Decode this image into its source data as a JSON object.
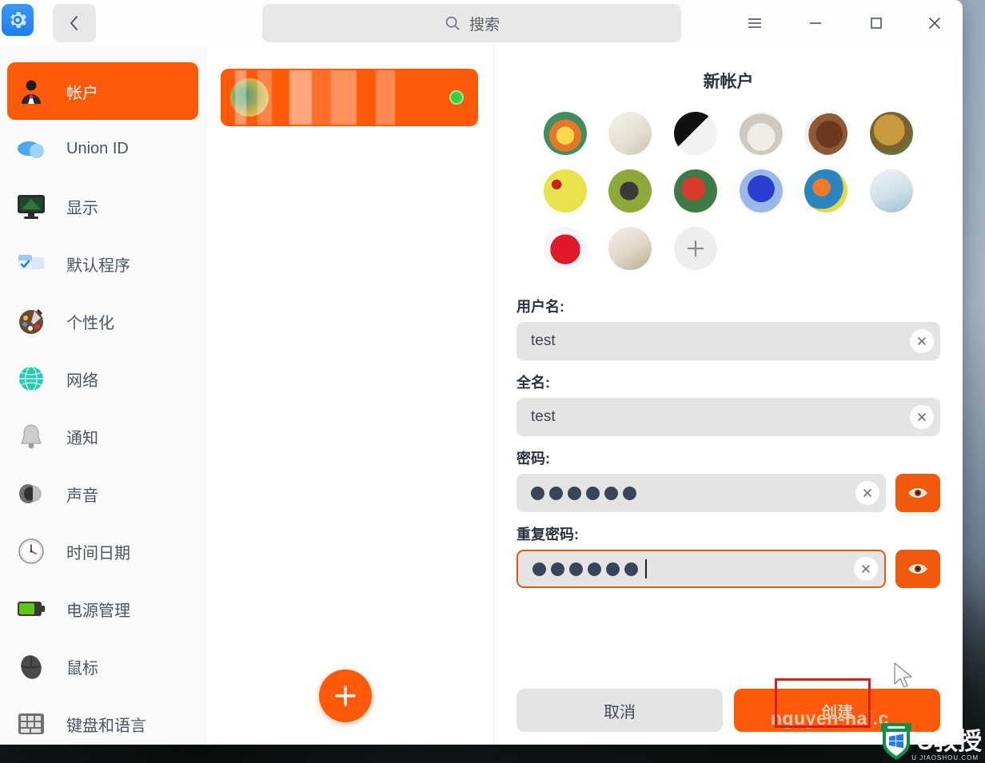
{
  "window": {
    "app_icon": "settings-gear-icon",
    "back_label": "‹",
    "controls": {
      "menu": "hamburger-menu-icon",
      "minimize": "minimize-icon",
      "maximize": "maximize-icon",
      "close": "close-icon"
    }
  },
  "search": {
    "placeholder": "搜索",
    "icon": "search-icon"
  },
  "sidebar": {
    "items": [
      {
        "label": "帐户",
        "icon": "user-account-icon",
        "active": true
      },
      {
        "label": "Union ID",
        "icon": "cloud-icon",
        "active": false
      },
      {
        "label": "显示",
        "icon": "monitor-icon",
        "active": false
      },
      {
        "label": "默认程序",
        "icon": "default-apps-icon",
        "active": false
      },
      {
        "label": "个性化",
        "icon": "palette-icon",
        "active": false
      },
      {
        "label": "网络",
        "icon": "network-globe-icon",
        "active": false
      },
      {
        "label": "通知",
        "icon": "bell-icon",
        "active": false
      },
      {
        "label": "声音",
        "icon": "speaker-icon",
        "active": false
      },
      {
        "label": "时间日期",
        "icon": "clock-icon",
        "active": false
      },
      {
        "label": "电源管理",
        "icon": "battery-icon",
        "active": false
      },
      {
        "label": "鼠标",
        "icon": "mouse-icon",
        "active": false
      },
      {
        "label": "键盘和语言",
        "icon": "keyboard-icon",
        "active": false
      }
    ]
  },
  "accounts_list": {
    "card": {
      "name_redacted": "",
      "status": "online",
      "status_color": "#35d43a",
      "selected": true
    },
    "add_button": {
      "icon": "plus-icon",
      "label": ""
    }
  },
  "new_account": {
    "title": "新帐户",
    "avatars": [
      {
        "name": "avatar-tulips"
      },
      {
        "name": "avatar-paper-plane"
      },
      {
        "name": "avatar-piano"
      },
      {
        "name": "avatar-kitten"
      },
      {
        "name": "avatar-horse"
      },
      {
        "name": "avatar-leopard"
      },
      {
        "name": "avatar-ladybugs"
      },
      {
        "name": "avatar-butterfly"
      },
      {
        "name": "avatar-parrot"
      },
      {
        "name": "avatar-hot-air-balloon"
      },
      {
        "name": "avatar-balloons"
      },
      {
        "name": "avatar-fish"
      },
      {
        "name": "avatar-raspberry"
      },
      {
        "name": "avatar-bed"
      }
    ],
    "add_avatar": {
      "icon": "plus-icon"
    },
    "fields": [
      {
        "label": "用户名:",
        "value": "test",
        "type": "text",
        "name": "username-field",
        "focused": false,
        "has_clear": true,
        "has_eye": false
      },
      {
        "label": "全名:",
        "value": "test",
        "type": "text",
        "name": "fullname-field",
        "focused": false,
        "has_clear": true,
        "has_eye": false
      },
      {
        "label": "密码:",
        "value": "••••••",
        "dot_count": 6,
        "type": "password",
        "name": "password-field",
        "focused": false,
        "has_clear": true,
        "has_eye": true
      },
      {
        "label": "重复密码:",
        "value": "••••••",
        "dot_count": 6,
        "type": "password",
        "name": "repeat-password-field",
        "focused": true,
        "has_clear": true,
        "has_eye": true
      }
    ],
    "buttons": {
      "cancel": "取消",
      "create": "创建"
    }
  },
  "annotation": {
    "highlight_color": "#d32020",
    "cursor": "mouse-pointer-icon",
    "overlay_text": "nguyen-hai.c"
  },
  "watermark": {
    "text": "U教授",
    "subtext": "U JIAOSHOU.COM",
    "icon": "shield-windows-icon"
  },
  "colors": {
    "accent": "#ff5a0a",
    "accent_dark": "#f15a0d",
    "field_bg": "#e4e4e4",
    "sidebar_bg": "#fafafa",
    "text": "#2b3340",
    "status_green": "#35d43a"
  }
}
